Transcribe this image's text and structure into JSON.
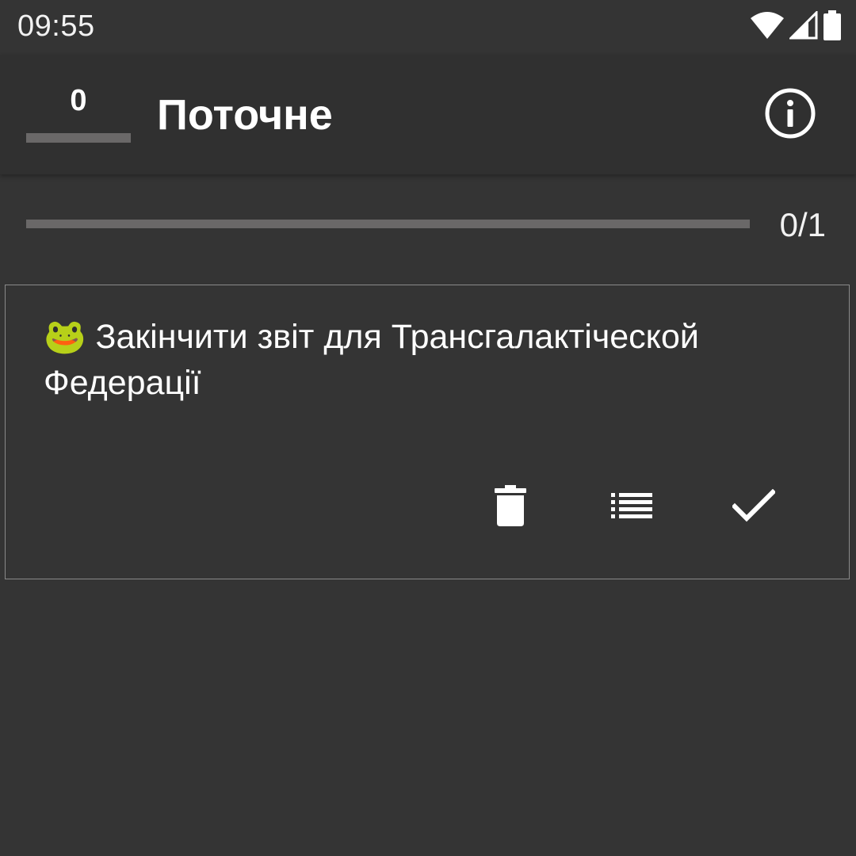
{
  "status_bar": {
    "time": "09:55",
    "icons": [
      "wifi-icon",
      "cellular-signal-icon",
      "battery-icon"
    ]
  },
  "app_bar": {
    "counter_value": "0",
    "title": "Поточне",
    "info_icon": "info-icon"
  },
  "progress": {
    "text": "0/1",
    "completed": 0,
    "total": 1,
    "fraction": 0
  },
  "tasks": [
    {
      "text": "🐸 Закінчити звіт для Трансгалактіческой Федерації",
      "actions": {
        "delete_icon": "trash-icon",
        "list_icon": "list-icon",
        "done_icon": "check-icon"
      }
    }
  ],
  "colors": {
    "background": "#343434",
    "app_bar": "#303030",
    "track": "#6a6868",
    "card_border": "#8a8a8a",
    "text": "#ffffff"
  }
}
